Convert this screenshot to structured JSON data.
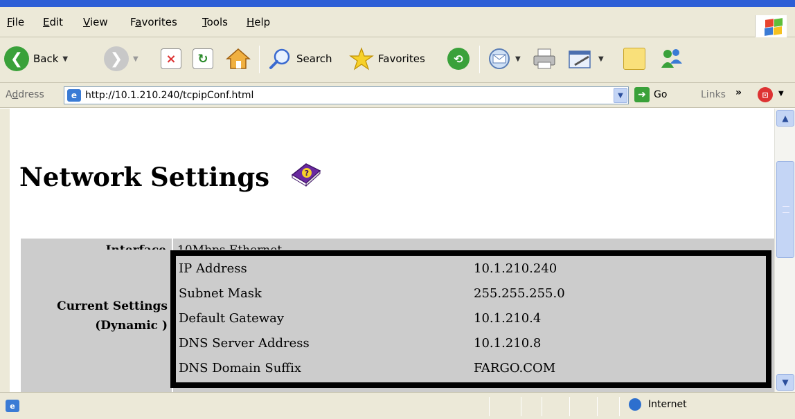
{
  "menu": {
    "items": [
      {
        "u": "F",
        "rest": "ile"
      },
      {
        "u": "E",
        "rest": "dit"
      },
      {
        "u": "V",
        "rest": "iew"
      },
      {
        "pre": "F",
        "u": "a",
        "rest": "vorites"
      },
      {
        "u": "T",
        "rest": "ools"
      },
      {
        "u": "H",
        "rest": "elp"
      }
    ]
  },
  "toolbar": {
    "back_label": "Back",
    "search_label": "Search",
    "favorites_label": "Favorites"
  },
  "address": {
    "label_pre": "A",
    "label_u": "d",
    "label_rest": "dress",
    "url": "http://10.1.210.240/tcpipConf.html",
    "go_label": "Go",
    "links_label": "Links",
    "links_chevron": "»"
  },
  "page": {
    "title": "Network Settings",
    "interface_label": "Interface",
    "interface_value": "10Mbps Ethernet",
    "current_label_line1": "Current Settings",
    "current_label_line2": "(Dynamic )",
    "settings": [
      {
        "key": "IP Address",
        "value": "10.1.210.240"
      },
      {
        "key": "Subnet Mask",
        "value": "255.255.255.0"
      },
      {
        "key": "Default Gateway",
        "value": "10.1.210.4"
      },
      {
        "key": "DNS Server Address",
        "value": "10.1.210.8"
      },
      {
        "key": "DNS Domain Suffix",
        "value": "FARGO.COM"
      }
    ]
  },
  "status": {
    "zone_label": "Internet"
  },
  "colors": {
    "chrome": "#ece9d8",
    "table_cell": "#cccccc",
    "accent_blue": "#2d5fd6"
  }
}
